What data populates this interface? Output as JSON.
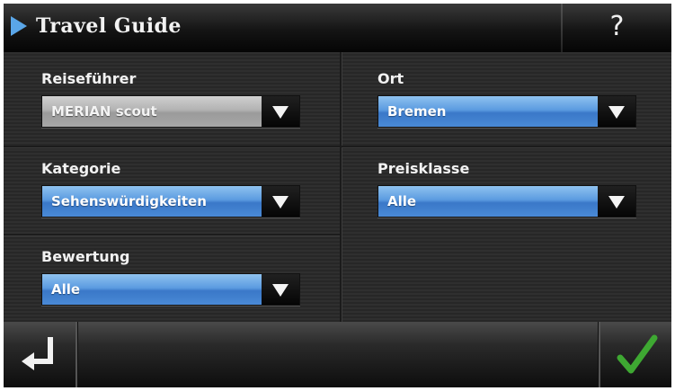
{
  "header": {
    "title": "Travel Guide",
    "help_label": "?"
  },
  "fields": {
    "reisefuehrer": {
      "label": "Reiseführer",
      "value": "MERIAN scout",
      "style": "gray"
    },
    "ort": {
      "label": "Ort",
      "value": "Bremen",
      "style": "blue"
    },
    "kategorie": {
      "label": "Kategorie",
      "value": "Sehenswürdigkeiten",
      "style": "blue"
    },
    "preisklasse": {
      "label": "Preisklasse",
      "value": "Alle",
      "style": "blue"
    },
    "bewertung": {
      "label": "Bewertung",
      "value": "Alle",
      "style": "blue"
    }
  },
  "footer": {
    "back_icon": "return-arrow-icon",
    "confirm_icon": "checkmark-icon"
  },
  "colors": {
    "accent_blue": "#4a8ad6",
    "title_arrow": "#5aa6e8",
    "checkmark_green": "#3ea832"
  }
}
